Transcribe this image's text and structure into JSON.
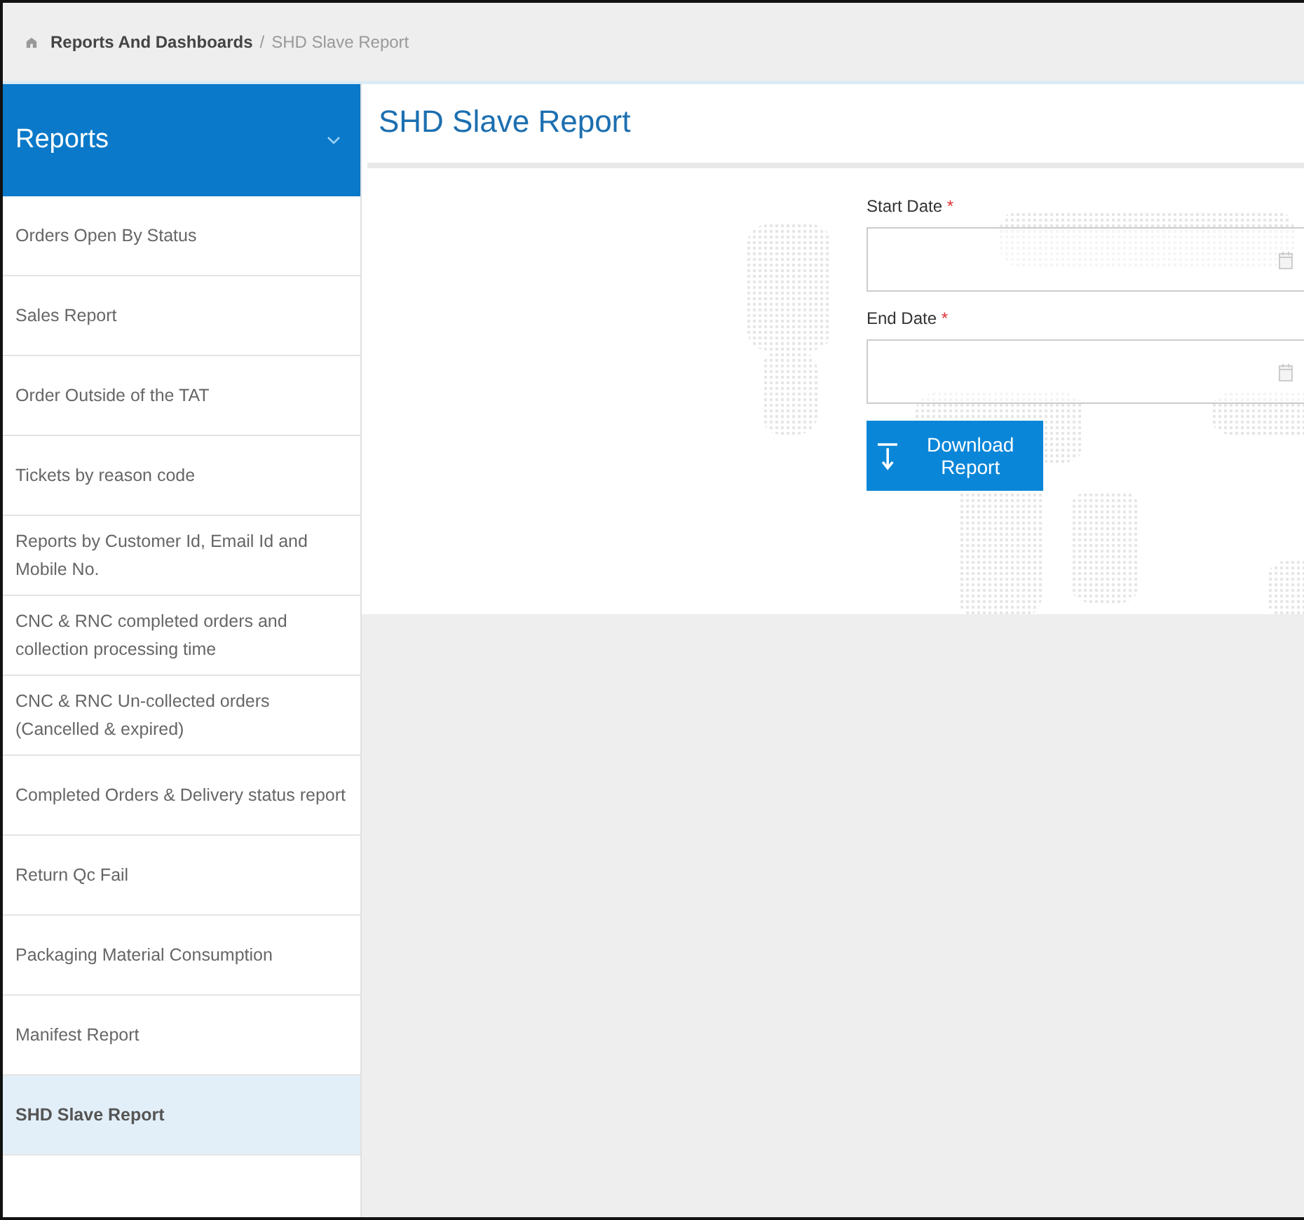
{
  "breadcrumb": {
    "parent": "Reports And Dashboards",
    "separator": "/",
    "current": "SHD Slave Report"
  },
  "sidebar": {
    "title": "Reports",
    "expanded": true,
    "items": [
      {
        "label": "Orders Open By Status",
        "selected": false
      },
      {
        "label": "Sales Report",
        "selected": false
      },
      {
        "label": "Order Outside of the TAT",
        "selected": false
      },
      {
        "label": "Tickets by reason code",
        "selected": false
      },
      {
        "label": "Reports by Customer Id, Email Id and Mobile No.",
        "selected": false
      },
      {
        "label": "CNC & RNC completed orders and collection processing time",
        "selected": false
      },
      {
        "label": "CNC & RNC Un-collected orders (Cancelled & expired)",
        "selected": false
      },
      {
        "label": "Completed Orders & Delivery status report",
        "selected": false
      },
      {
        "label": "Return Qc Fail",
        "selected": false
      },
      {
        "label": "Packaging Material Consumption",
        "selected": false
      },
      {
        "label": "Manifest Report",
        "selected": false
      },
      {
        "label": "SHD Slave Report",
        "selected": true
      }
    ]
  },
  "page": {
    "title": "SHD Slave Report",
    "fields": [
      {
        "label": "Start Date",
        "required_mark": "*"
      },
      {
        "label": "End Date",
        "required_mark": "*"
      }
    ],
    "button": "Download Report"
  }
}
